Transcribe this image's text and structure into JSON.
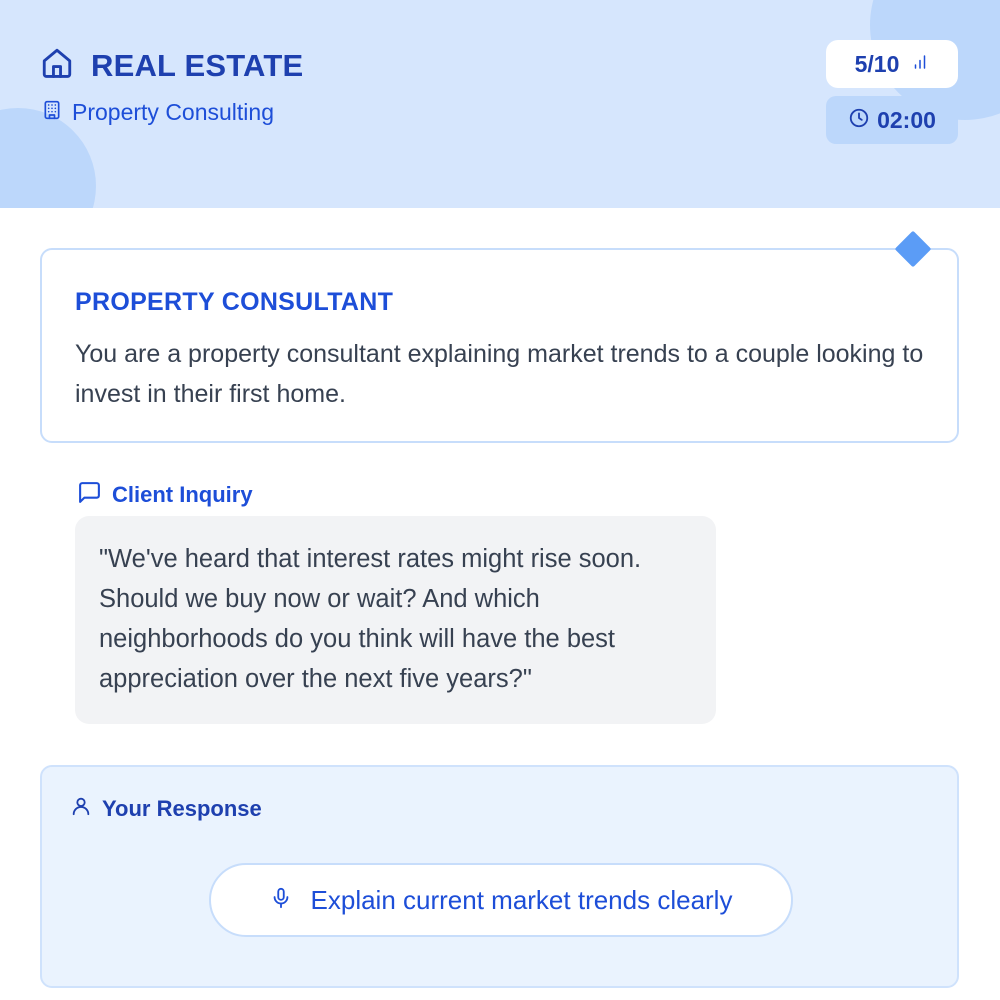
{
  "header": {
    "category": "REAL ESTATE",
    "category_icon": "home-icon",
    "subcategory": "Property Consulting",
    "subcategory_icon": "building-icon",
    "progress": "5/10",
    "progress_icon": "bar-chart-icon",
    "timer": "02:00",
    "timer_icon": "clock-icon"
  },
  "scenario": {
    "role_title": "PROPERTY CONSULTANT",
    "role_description": "You are a property consultant explaining market trends to a couple looking to invest in their first home."
  },
  "inquiry": {
    "label": "Client Inquiry",
    "label_icon": "chat-icon",
    "text": "\"We've heard that interest rates might rise soon. Should we buy now or wait? And which neighborhoods do you think will have the best appreciation over the next five years?\""
  },
  "response": {
    "label": "Your Response",
    "label_icon": "user-icon",
    "suggestion_label": "Explain current market trends clearly",
    "suggestion_icon": "microphone-icon"
  },
  "colors": {
    "header_bg": "#d6e6fd",
    "accent": "#1d4ed8",
    "accent_dark": "#1e40af",
    "diamond": "#5b9cf6",
    "bubble_bg": "#f2f3f5",
    "panel_bg": "#eaf3fe"
  }
}
